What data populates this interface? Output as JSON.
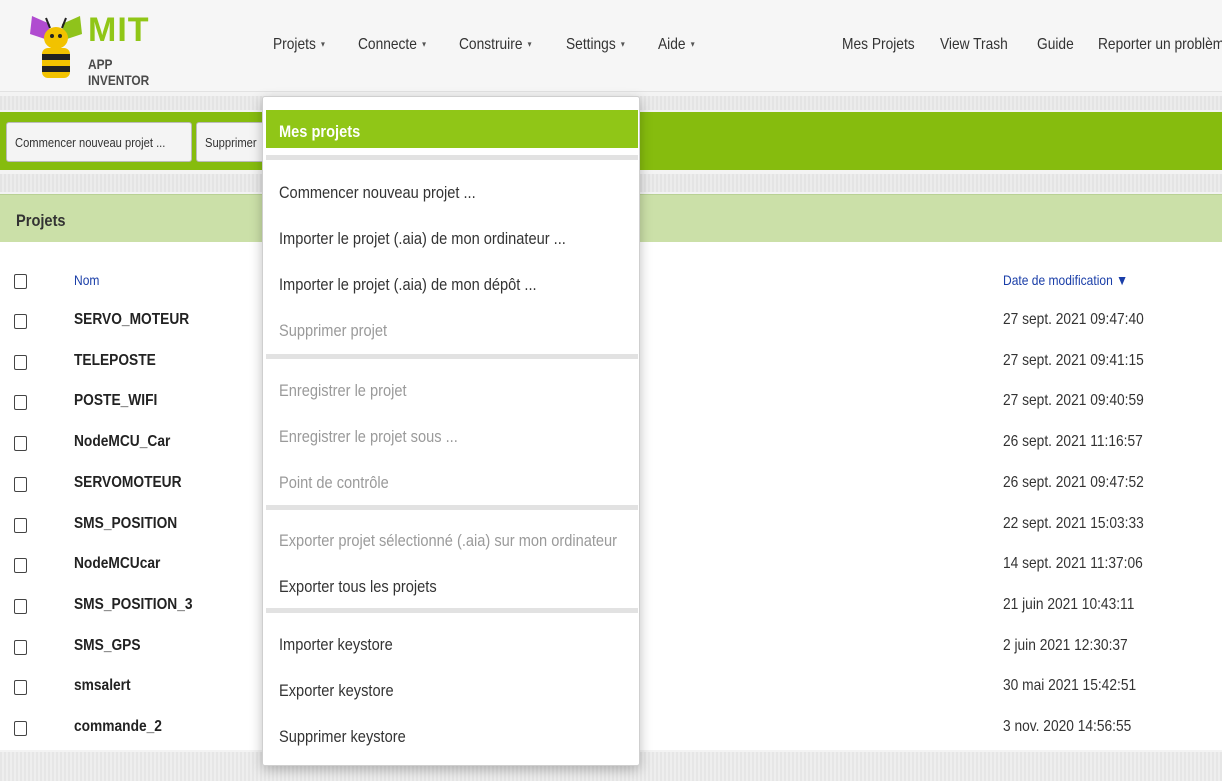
{
  "logo": {
    "title": "MIT",
    "subtitle": "APP INVENTOR"
  },
  "nav": {
    "menus": [
      "Projets",
      "Connecte",
      "Construire",
      "Settings",
      "Aide"
    ],
    "caret": "▾",
    "links": [
      "Mes Projets",
      "View Trash",
      "Guide",
      "Reporter un problème"
    ]
  },
  "toolbar": {
    "new_project": "Commencer nouveau projet ...",
    "delete": "Supprimer"
  },
  "projects": {
    "title": "Projets",
    "col_name": "Nom",
    "col_date": "Date de modification ▼",
    "rows": [
      {
        "name": "SERVO_MOTEUR",
        "date": "27 sept. 2021 09:47:40"
      },
      {
        "name": "TELEPOSTE",
        "date": "27 sept. 2021 09:41:15"
      },
      {
        "name": "POSTE_WIFI",
        "date": "27 sept. 2021 09:40:59"
      },
      {
        "name": "NodeMCU_Car",
        "date": "26 sept. 2021 11:16:57"
      },
      {
        "name": "SERVOMOTEUR",
        "date": "26 sept. 2021 09:47:52"
      },
      {
        "name": "SMS_POSITION",
        "date": "22 sept. 2021 15:03:33"
      },
      {
        "name": "NodeMCUcar",
        "date": "14 sept. 2021 11:37:06"
      },
      {
        "name": "SMS_POSITION_3",
        "date": "21 juin 2021 10:43:11"
      },
      {
        "name": "SMS_GPS",
        "date": "2 juin 2021 12:30:37"
      },
      {
        "name": "smsalert",
        "date": "30 mai 2021 15:42:51"
      },
      {
        "name": "commande_2",
        "date": "3 nov. 2020 14:56:55"
      }
    ]
  },
  "dropdown": {
    "items": [
      {
        "label": "Mes projets",
        "state": "active"
      },
      {
        "label": "Commencer nouveau projet ...",
        "state": "enabled"
      },
      {
        "label": "Importer le projet (.aia) de mon ordinateur ...",
        "state": "enabled"
      },
      {
        "label": "Importer le projet (.aia) de mon dépôt ...",
        "state": "enabled"
      },
      {
        "label": "Supprimer projet",
        "state": "disabled"
      },
      {
        "label": "Enregistrer le projet",
        "state": "disabled"
      },
      {
        "label": "Enregistrer le projet sous ...",
        "state": "disabled"
      },
      {
        "label": "Point de contrôle",
        "state": "disabled"
      },
      {
        "label": "Exporter projet sélectionné (.aia) sur mon ordinateur",
        "state": "disabled"
      },
      {
        "label": "Exporter tous les projets",
        "state": "enabled"
      },
      {
        "label": "Importer keystore",
        "state": "enabled"
      },
      {
        "label": "Exporter keystore",
        "state": "enabled"
      },
      {
        "label": "Supprimer keystore",
        "state": "enabled"
      }
    ]
  },
  "colors": {
    "brand_green": "#90c617",
    "toolbar_green": "#86bc0e",
    "header_green": "#cbe0a8",
    "link_blue": "#1a3ea8"
  }
}
